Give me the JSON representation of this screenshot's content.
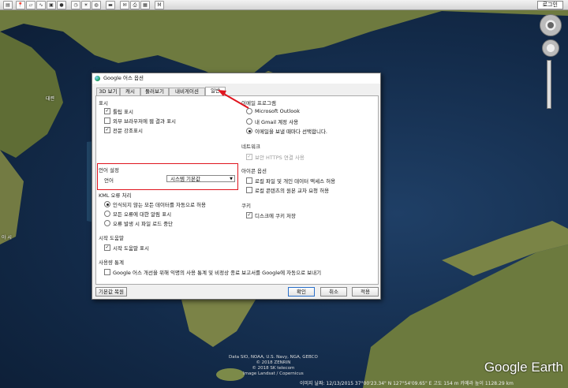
{
  "toolbar": {
    "login_label": "로그인",
    "icons": [
      "sidebar-icon",
      "placemark-icon",
      "polygon-icon",
      "path-icon",
      "overlay-icon",
      "tour-icon",
      "history-icon",
      "sun-icon",
      "planet-icon",
      "ruler-icon",
      "email-icon",
      "print-icon",
      "save-image-icon",
      "maps-icon"
    ]
  },
  "map": {
    "places": [
      {
        "name": "대련",
        "key": "dalian"
      },
      {
        "name": "아 시",
        "key": "asia"
      }
    ],
    "credits": [
      "Data SIO, NOAA, U.S. Navy, NGA, GEBCO",
      "© 2018 ZENRIN",
      "© 2018 SK telecom",
      "Image Landsat / Copernicus"
    ],
    "status": "이미지 날짜: 12/13/2015   37°00'23.34\" N  127°54'09.65\" E  고도  154 m    카메라 높이 1128.29 km",
    "branding": "Google Earth"
  },
  "dialog": {
    "title": "Google 어스 옵션",
    "tabs": [
      "3D 보기",
      "캐시",
      "둘러보기",
      "내비게이션",
      "일반"
    ],
    "active_tab": 4,
    "display": {
      "title": "표시",
      "items": [
        {
          "label": "툴팁 표시",
          "checked": true
        },
        {
          "label": "외부 브라우저에 웹 결과 표시",
          "checked": false
        },
        {
          "label": "전문 강조표시",
          "checked": true
        }
      ]
    },
    "language": {
      "title": "언어 설정",
      "label": "언어",
      "value": "시스템 기본값"
    },
    "kml": {
      "title": "KML 오류 처리",
      "options": [
        {
          "label": "인식되지 않는 모든 데이터를 자동으로 허용",
          "selected": true
        },
        {
          "label": "모든 오류에 대한 알림 표시",
          "selected": false
        },
        {
          "label": "오류 발생 시 파일 로드 중단",
          "selected": false
        }
      ]
    },
    "startup": {
      "title": "시작 도움말",
      "items": [
        {
          "label": "시작 도움말 표시",
          "checked": true
        }
      ]
    },
    "usage": {
      "title": "사용량 통계",
      "items": [
        {
          "label": "Google 어스 개선을 위해 익명의 사용 통계 및 비정상 종료 보고서를 Google에 자동으로 보내기",
          "checked": false
        }
      ]
    },
    "email": {
      "title": "이메일 프로그램",
      "options": [
        {
          "label": "Microsoft Outlook",
          "selected": false
        },
        {
          "label": "내 Gmail 계정 사용",
          "selected": false
        },
        {
          "label": "이메일을 보낼 때마다 선택합니다.",
          "selected": true
        }
      ]
    },
    "network": {
      "title": "네트워크",
      "items": [
        {
          "label": "보안 HTTPS 연결 사용",
          "checked": true,
          "disabled": true
        }
      ]
    },
    "privacy": {
      "title": "아이콘 옵션",
      "items": [
        {
          "label": "로컬 파일 및 개인 데이터 액세스 허용",
          "checked": false
        },
        {
          "label": "로컬 콘텐츠의 원본 교차 요청 허용",
          "checked": false
        }
      ]
    },
    "cookies": {
      "title": "쿠키",
      "items": [
        {
          "label": "디스크에 쿠키 저장",
          "checked": true
        }
      ]
    },
    "buttons": {
      "reset": "기본값 복원",
      "ok": "확인",
      "cancel": "취소",
      "apply": "적용"
    }
  },
  "colors": {
    "highlight_box": "#e0141e",
    "ocean": "#132b4a",
    "land": "#6f7a3c"
  }
}
